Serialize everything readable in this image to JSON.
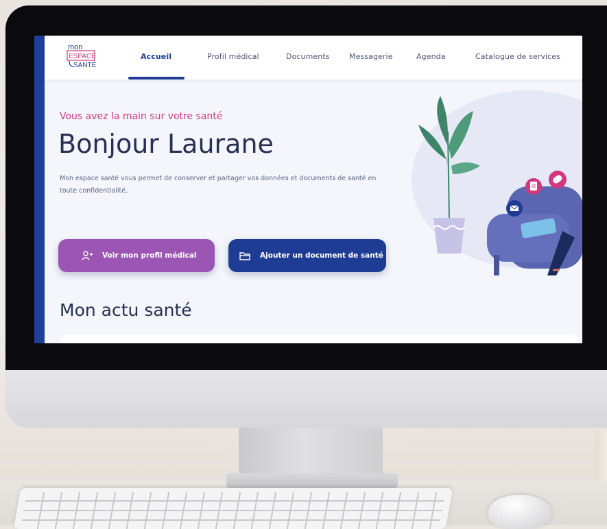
{
  "colors": {
    "brand_blue": "#1f3c95",
    "brand_pink": "#d2387f",
    "profile_purple": "#9b56b4",
    "text_dark": "#273050"
  },
  "logo": {
    "line1": "mon",
    "line2": "ESPACE",
    "line3": "SANTÉ"
  },
  "nav": {
    "items": [
      {
        "label": "Accueil",
        "active": true
      },
      {
        "label": "Profil médical",
        "active": false
      },
      {
        "label": "Documents",
        "active": false
      },
      {
        "label": "Messagerie",
        "active": false
      },
      {
        "label": "Agenda",
        "active": false
      },
      {
        "label": "Catalogue de services",
        "active": false
      }
    ]
  },
  "hero": {
    "tagline": "Vous avez la main sur votre santé",
    "greeting": "Bonjour Laurane",
    "intro": "Mon espace santé vous permet de conserver et partager vos données et documents de santé en toute confidentialité."
  },
  "actions": {
    "profile_button": {
      "label": "Voir mon profil médical",
      "icon": "person-add-icon"
    },
    "document_button": {
      "label": "Ajouter un document de santé",
      "icon": "folder-icon"
    }
  },
  "section": {
    "title": "Mon actu santé"
  },
  "illustration": {
    "icons": [
      "document-icon",
      "pill-icon",
      "mail-icon"
    ]
  }
}
